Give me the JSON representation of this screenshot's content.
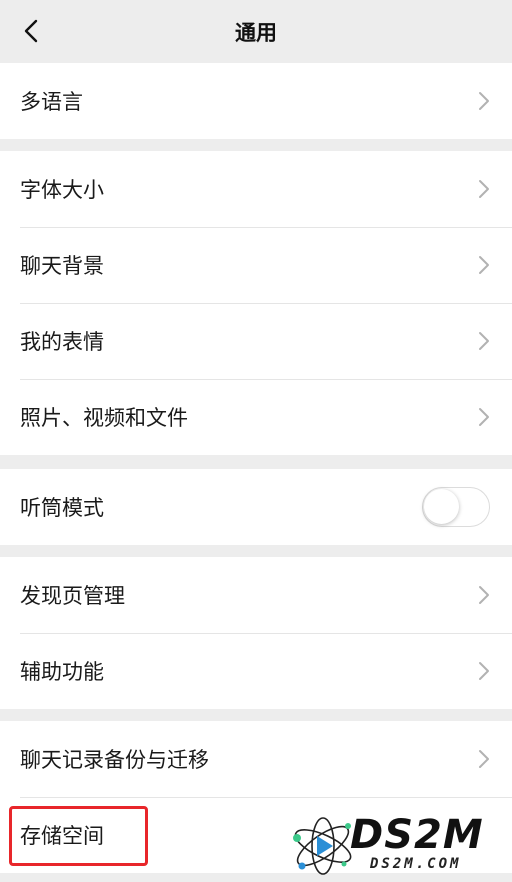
{
  "header": {
    "title": "通用",
    "back_icon": "chevron-left-icon"
  },
  "groups": [
    {
      "items": [
        {
          "label": "多语言",
          "control": "chevron"
        }
      ]
    },
    {
      "items": [
        {
          "label": "字体大小",
          "control": "chevron"
        },
        {
          "label": "聊天背景",
          "control": "chevron"
        },
        {
          "label": "我的表情",
          "control": "chevron"
        },
        {
          "label": "照片、视频和文件",
          "control": "chevron"
        }
      ]
    },
    {
      "items": [
        {
          "label": "听筒模式",
          "control": "toggle",
          "toggle_on": false
        }
      ]
    },
    {
      "items": [
        {
          "label": "发现页管理",
          "control": "chevron"
        },
        {
          "label": "辅助功能",
          "control": "chevron"
        }
      ]
    },
    {
      "items": [
        {
          "label": "聊天记录备份与迁移",
          "control": "chevron"
        },
        {
          "label": "存储空间",
          "control": "none"
        }
      ]
    }
  ],
  "annotation": {
    "highlight_color": "#e8262a"
  },
  "watermark": {
    "brand": "DS2M",
    "domain": "DS2M.COM"
  },
  "colors": {
    "background": "#ededed",
    "surface": "#ffffff",
    "divider": "#e5e5e5"
  }
}
